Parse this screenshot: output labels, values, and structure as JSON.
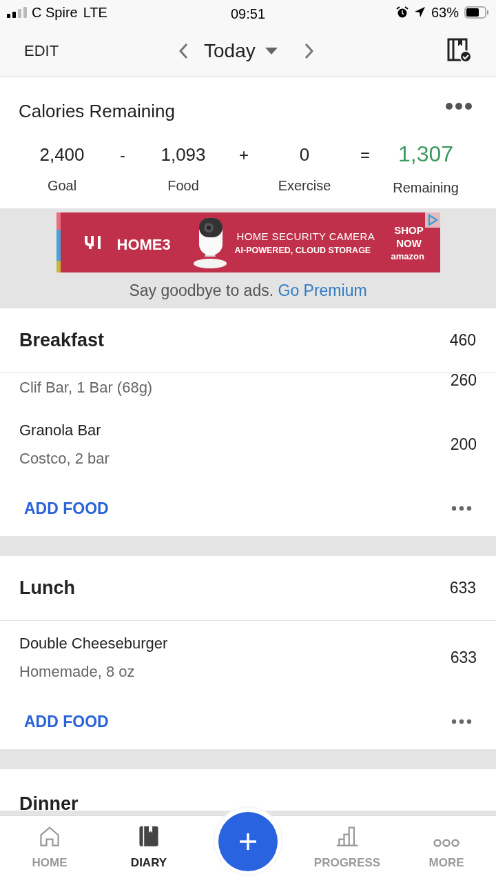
{
  "status_bar": {
    "carrier": "C Spire",
    "network": "LTE",
    "time": "09:51",
    "battery": "63%"
  },
  "nav": {
    "edit": "EDIT",
    "date": "Today"
  },
  "calories": {
    "title": "Calories Remaining",
    "terms": [
      {
        "value": "2,400",
        "label": "Goal",
        "kind": "term"
      },
      {
        "value": "-",
        "kind": "operator"
      },
      {
        "value": "1,093",
        "label": "Food",
        "kind": "term"
      },
      {
        "value": "+",
        "kind": "operator"
      },
      {
        "value": "0",
        "label": "Exercise",
        "kind": "term"
      },
      {
        "value": "=",
        "kind": "operator"
      },
      {
        "value": "1,307",
        "label": "Remaining",
        "kind": "result"
      }
    ]
  },
  "ad": {
    "brand": "HOME3",
    "headline": "HOME SECURITY CAMERA",
    "subline": "AI-POWERED, CLOUD STORAGE",
    "cta": "SHOP NOW",
    "store": "amazon",
    "note": "Say goodbye to ads.",
    "link": "Go Premium"
  },
  "meals": [
    {
      "name": "Breakfast",
      "total": "460",
      "items": [
        {
          "kind": "partial",
          "description": "Clif Bar, 1 Bar (68g)",
          "calories": "260"
        },
        {
          "kind": "full",
          "name": "Granola Bar",
          "description": "Costco, 2 bar",
          "calories": "200"
        }
      ],
      "action": "ADD FOOD"
    },
    {
      "name": "Lunch",
      "total": "633",
      "items": [
        {
          "kind": "full",
          "name": "Double Cheeseburger",
          "description": "Homemade, 8 oz",
          "calories": "633"
        }
      ],
      "action": "ADD FOOD"
    },
    {
      "name": "Dinner"
    }
  ],
  "tabs": [
    {
      "label": "HOME",
      "selected": false,
      "kind": "home"
    },
    {
      "label": "DIARY",
      "selected": true,
      "kind": "diary"
    },
    {
      "kind": "add"
    },
    {
      "label": "PROGRESS",
      "selected": false,
      "kind": "progress"
    },
    {
      "label": "MORE",
      "selected": false,
      "kind": "more"
    }
  ]
}
